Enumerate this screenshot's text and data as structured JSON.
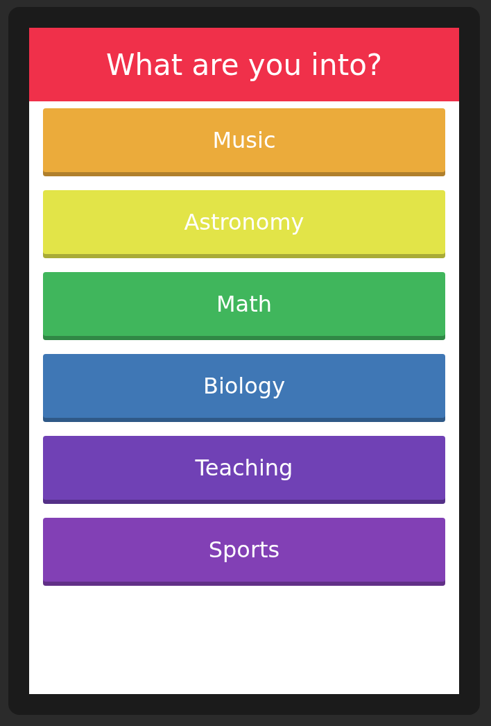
{
  "header": {
    "title": "What are you into?"
  },
  "options": [
    {
      "label": "Music",
      "color": "#ebab3b"
    },
    {
      "label": "Astronomy",
      "color": "#e2e448"
    },
    {
      "label": "Math",
      "color": "#40b65c"
    },
    {
      "label": "Biology",
      "color": "#3f77b5"
    },
    {
      "label": "Teaching",
      "color": "#7041b5"
    },
    {
      "label": "Sports",
      "color": "#8240b5"
    }
  ]
}
